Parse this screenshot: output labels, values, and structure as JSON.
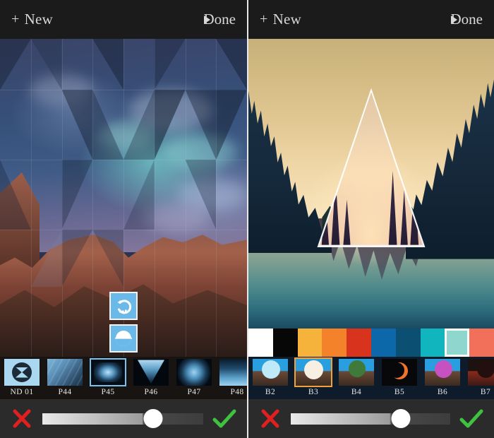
{
  "app": {
    "title": "Photo Filter Editor",
    "panels": [
      {
        "id": "left",
        "header": {
          "new_label": "New",
          "plus": "+",
          "done_label": "Done",
          "done_arrow": "play-triangle-icon"
        },
        "photo": {
          "subject": "red rock canyon with blue clouded sky and triangular geometric overlay"
        },
        "float_buttons": [
          {
            "name": "undo-button",
            "icon": "undo-arrow-icon",
            "color": "#6ab9e8"
          },
          {
            "name": "gradient-toggle-button",
            "icon": "half-circle-gradient-icon",
            "color": "#6ab9e8"
          }
        ],
        "filters": {
          "selected": "P45",
          "selection_color": "#79c4ef",
          "items": [
            {
              "label": "ND 01",
              "style": "nd"
            },
            {
              "label": "P44",
              "style": "p44"
            },
            {
              "label": "P45",
              "style": "p45"
            },
            {
              "label": "P46",
              "style": "p46"
            },
            {
              "label": "P47",
              "style": "p47"
            },
            {
              "label": "P48",
              "style": "p48"
            }
          ]
        },
        "toolbar": {
          "cancel_label": "cancel-x-icon",
          "cancel_color": "#e02020",
          "confirm_label": "confirm-check-icon",
          "confirm_color": "#3fc23f",
          "slider_value": 69,
          "slider_min": 0,
          "slider_max": 100
        }
      },
      {
        "id": "right",
        "header": {
          "new_label": "New",
          "plus": "+",
          "done_label": "Done",
          "done_arrow": "play-triangle-icon"
        },
        "photo": {
          "subject": "forest lake at golden hour with white triangle overlay"
        },
        "swatches": {
          "selected_index": 8,
          "selection_color": "#ffffff",
          "colors": [
            "#ffffff",
            "#070707",
            "#f6b33c",
            "#f4822b",
            "#d8331c",
            "#0c68a8",
            "#0b4f72",
            "#10b5bd",
            "#8fd6cf",
            "#f2705a"
          ]
        },
        "filters": {
          "selected": "B3",
          "selection_color": "#f0a03c",
          "items": [
            {
              "label": "B2",
              "style": "b2"
            },
            {
              "label": "B3",
              "style": "b3"
            },
            {
              "label": "B4",
              "style": "b4"
            },
            {
              "label": "B5",
              "style": "b5"
            },
            {
              "label": "B6",
              "style": "b6"
            },
            {
              "label": "B7",
              "style": "b7"
            }
          ]
        },
        "toolbar": {
          "cancel_label": "cancel-x-icon",
          "cancel_color": "#e02020",
          "confirm_label": "confirm-check-icon",
          "confirm_color": "#3fc23f",
          "slider_value": 69,
          "slider_min": 0,
          "slider_max": 100
        }
      }
    ]
  }
}
